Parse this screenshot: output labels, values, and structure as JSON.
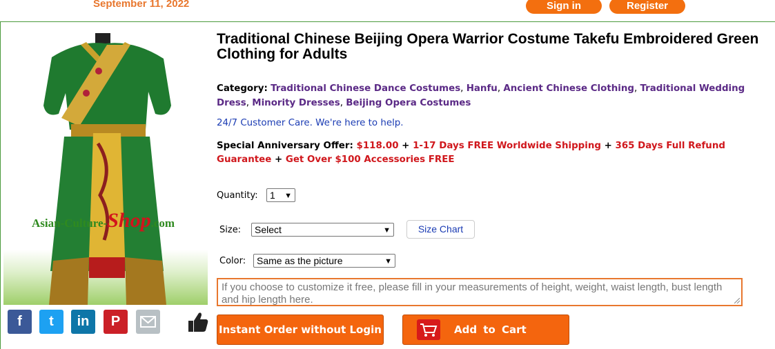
{
  "header": {
    "date": "September 11, 2022",
    "signin_label": "Sign in",
    "register_label": "Register"
  },
  "image": {
    "watermark_prefix": "Asian-Culture-",
    "watermark_shop": "Shop",
    "watermark_suffix": ".com"
  },
  "share": {
    "facebook": "f",
    "twitter": "t",
    "linkedin": "in",
    "pinterest": "P"
  },
  "product": {
    "title": "Traditional Chinese Beijing Opera Warrior Costume Takefu Embroidered Green Clothing for Adults",
    "category_label": "Category:",
    "categories": [
      "Traditional Chinese Dance Costumes",
      "Hanfu",
      "Ancient Chinese Clothing",
      "Traditional Wedding Dress",
      "Minority Dresses",
      "Beijing Opera Costumes"
    ],
    "customer_care": "24/7 Customer Care. We're here to help.",
    "offer": {
      "label": "Special Anniversary Offer:",
      "price": "$118.00",
      "shipping": "1-17 Days FREE Worldwide Shipping",
      "refund": "365 Days Full Refund Guarantee",
      "accessories": "Get Over $100 Accessories FREE"
    }
  },
  "form": {
    "quantity_label": "Quantity:",
    "quantity_value": "1",
    "size_label": "Size:",
    "size_value": "Select",
    "size_chart_label": "Size Chart",
    "color_label": "Color:",
    "color_value": "Same as the picture",
    "note_placeholder": "If you choose to customize it free, please fill in your measurements of height, weight, waist length, bust length and hip length here."
  },
  "actions": {
    "instant_order_label": "Instant Order without Login",
    "add_to_cart_label": "Add to Cart"
  },
  "colors": {
    "accent": "#f4650e",
    "category_link": "#5b2a86",
    "offer_red": "#d0171c",
    "link_blue": "#1a3bb3"
  }
}
